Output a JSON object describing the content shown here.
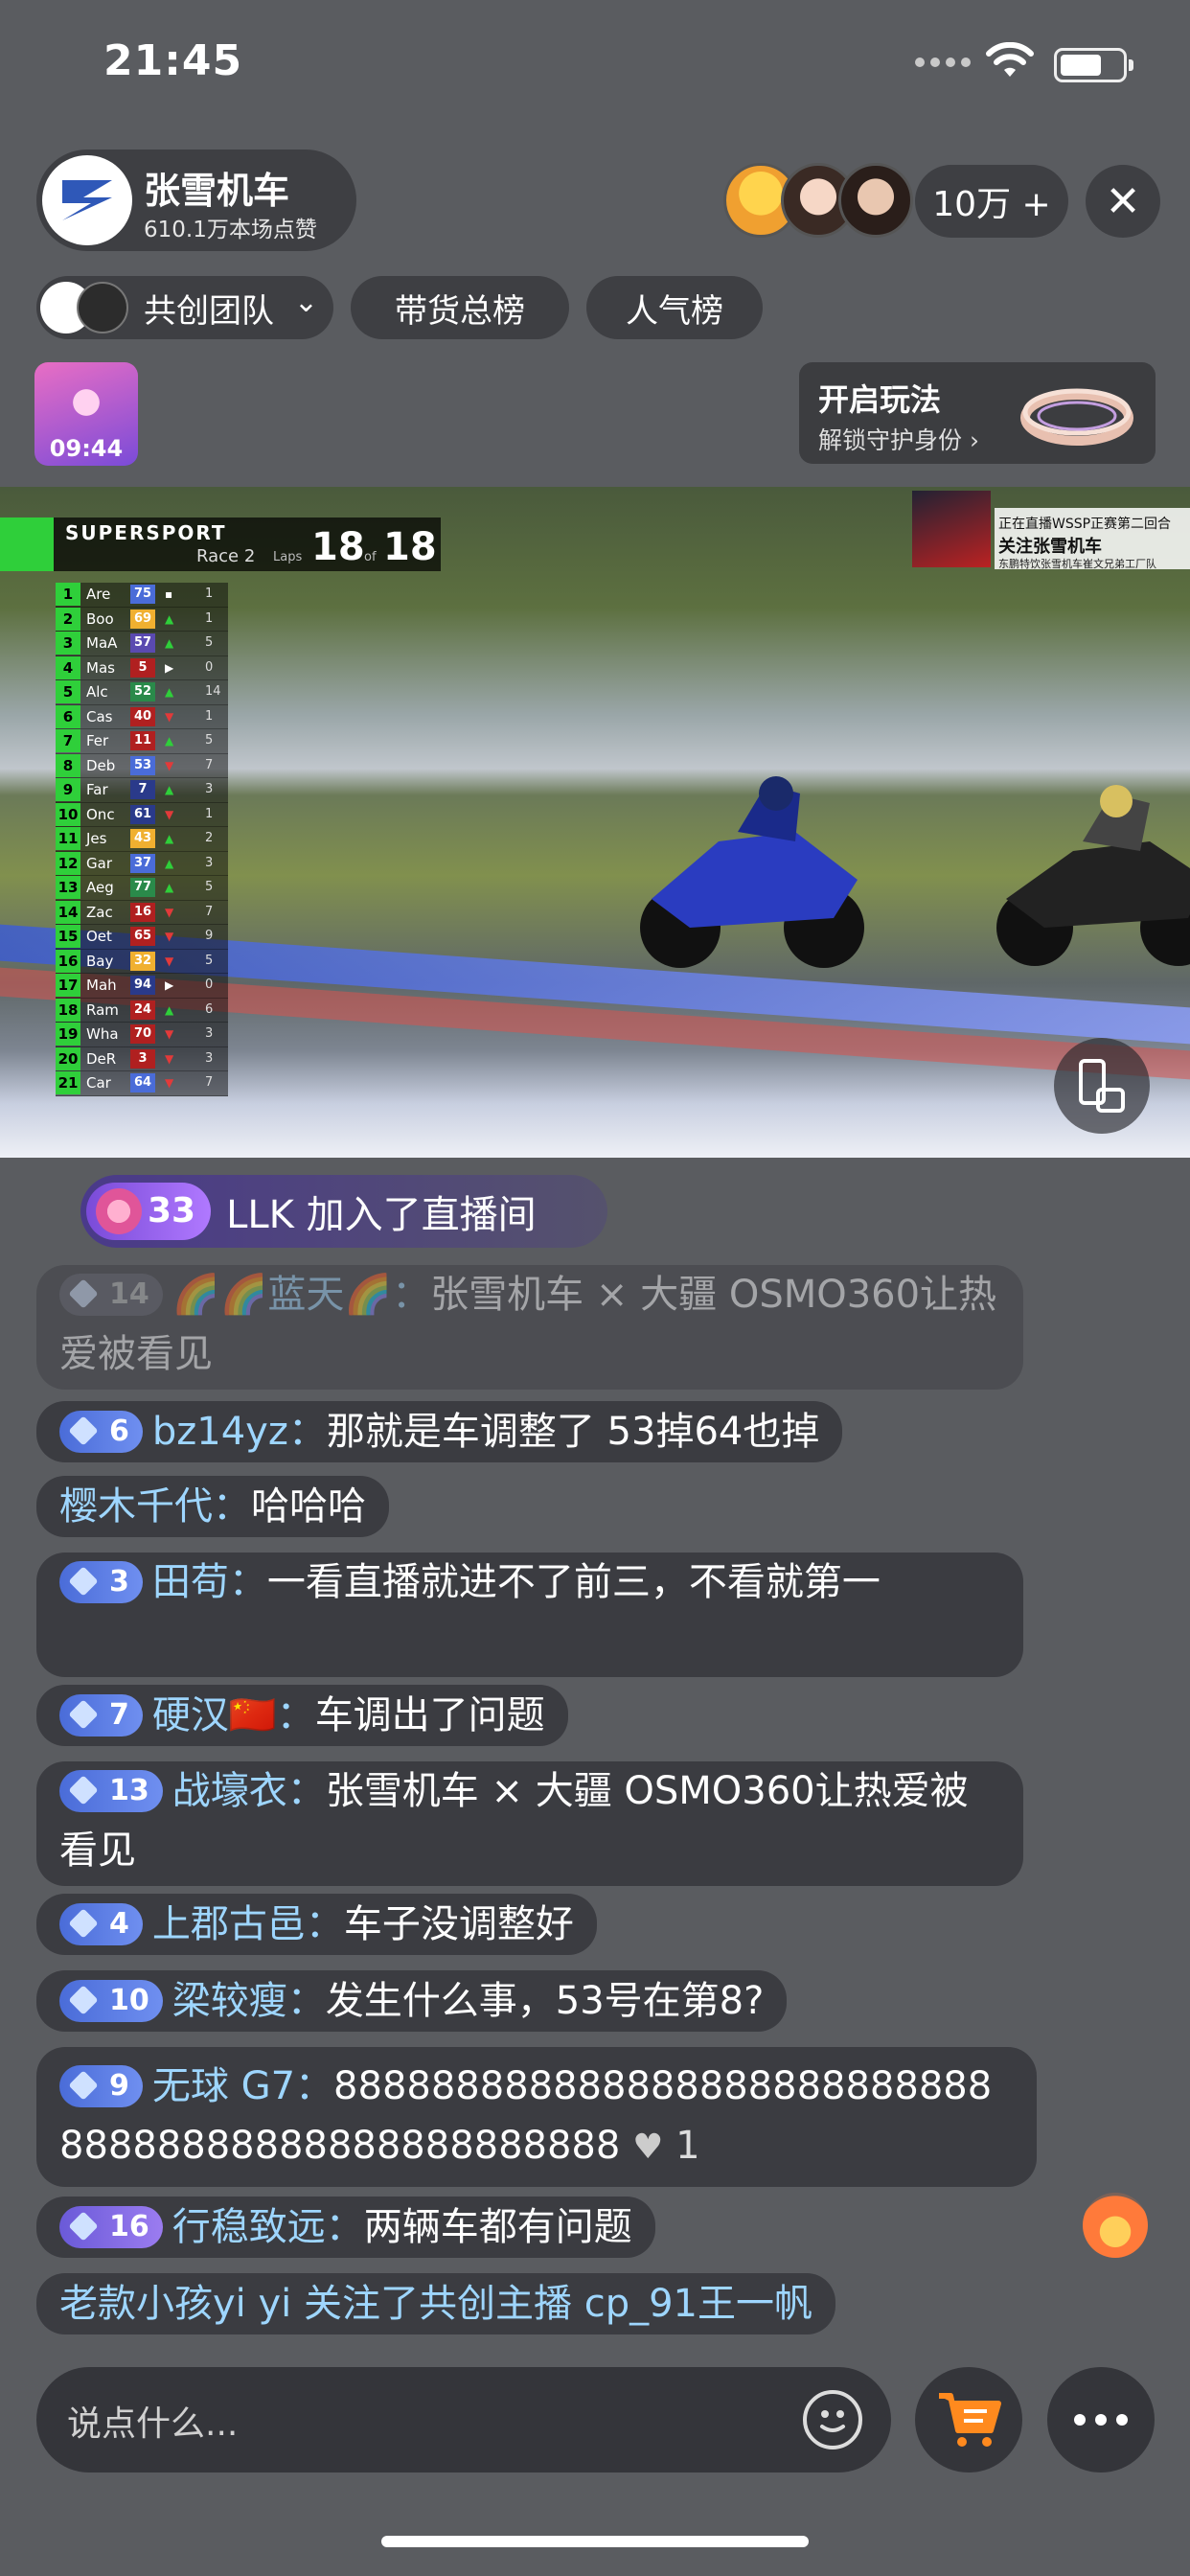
{
  "status_bar": {
    "time": "21:45"
  },
  "host": {
    "name": "张雪机车",
    "likes": "610.1万本场点赞"
  },
  "viewers": {
    "count": "10万 +",
    "close": "✕"
  },
  "tabs": [
    {
      "label": "共创团队"
    },
    {
      "label": "带货总榜"
    },
    {
      "label": "人气榜"
    }
  ],
  "gift": {
    "timer": "09:44"
  },
  "play_card": {
    "title": "开启玩法",
    "subtitle": "解锁守护身份 ›"
  },
  "video": {
    "series": "SUPERSPORT",
    "race": "Race 2",
    "laps_label": "Laps",
    "laps_current": "18",
    "laps_of": "of",
    "laps_total": "18",
    "promo": {
      "line1": "正在直播WSSP正赛第二回合",
      "line2": "关注张雪机车",
      "line3": "东鹏特饮张雪机车崔文兄弟工厂队"
    },
    "standings": [
      {
        "pos": "1",
        "name": "Are",
        "num": "75",
        "color": "#4a6cd8",
        "arrow": "▪",
        "delta": "1"
      },
      {
        "pos": "2",
        "name": "Boo",
        "num": "69",
        "color": "#f0b030",
        "arrow": "▲",
        "delta": "1"
      },
      {
        "pos": "3",
        "name": "MaA",
        "num": "57",
        "color": "#5a4ab0",
        "arrow": "▲",
        "delta": "5"
      },
      {
        "pos": "4",
        "name": "Mas",
        "num": "5",
        "color": "#b02020",
        "arrow": "▶",
        "delta": "0"
      },
      {
        "pos": "5",
        "name": "Alc",
        "num": "52",
        "color": "#2a8a4a",
        "arrow": "▲",
        "delta": "14"
      },
      {
        "pos": "6",
        "name": "Cas",
        "num": "40",
        "color": "#b02020",
        "arrow": "▼",
        "delta": "1"
      },
      {
        "pos": "7",
        "name": "Fer",
        "num": "11",
        "color": "#b02020",
        "arrow": "▲",
        "delta": "5"
      },
      {
        "pos": "8",
        "name": "Deb",
        "num": "53",
        "color": "#4a6cd8",
        "arrow": "▼",
        "delta": "7"
      },
      {
        "pos": "9",
        "name": "Far",
        "num": "7",
        "color": "#2a3a8a",
        "arrow": "▲",
        "delta": "3"
      },
      {
        "pos": "10",
        "name": "Onc",
        "num": "61",
        "color": "#2a3a8a",
        "arrow": "▼",
        "delta": "1"
      },
      {
        "pos": "11",
        "name": "Jes",
        "num": "43",
        "color": "#f0b030",
        "arrow": "▲",
        "delta": "2"
      },
      {
        "pos": "12",
        "name": "Gar",
        "num": "37",
        "color": "#4a6cd8",
        "arrow": "▲",
        "delta": "3"
      },
      {
        "pos": "13",
        "name": "Aeg",
        "num": "77",
        "color": "#2a8a4a",
        "arrow": "▲",
        "delta": "5"
      },
      {
        "pos": "14",
        "name": "Zac",
        "num": "16",
        "color": "#b02020",
        "arrow": "▼",
        "delta": "7"
      },
      {
        "pos": "15",
        "name": "Oet",
        "num": "65",
        "color": "#b02020",
        "arrow": "▼",
        "delta": "9"
      },
      {
        "pos": "16",
        "name": "Bay",
        "num": "32",
        "color": "#f0b030",
        "arrow": "▼",
        "delta": "5"
      },
      {
        "pos": "17",
        "name": "Mah",
        "num": "94",
        "color": "#2a3a8a",
        "arrow": "▶",
        "delta": "0"
      },
      {
        "pos": "18",
        "name": "Ram",
        "num": "24",
        "color": "#b02020",
        "arrow": "▲",
        "delta": "6"
      },
      {
        "pos": "19",
        "name": "Wha",
        "num": "70",
        "color": "#b02020",
        "arrow": "▼",
        "delta": "3"
      },
      {
        "pos": "20",
        "name": "DeR",
        "num": "3",
        "color": "#b02020",
        "arrow": "▼",
        "delta": "3"
      },
      {
        "pos": "21",
        "name": "Car",
        "num": "64",
        "color": "#4a6cd8",
        "arrow": "▼",
        "delta": "7"
      }
    ]
  },
  "join": {
    "level": "33",
    "text": "LLK 加入了直播间"
  },
  "comments": {
    "faded": {
      "level": "14",
      "name": "🌈🌈蓝天🌈：",
      "text": "张雪机车 × 大疆 OSMO360让热爱被看见"
    },
    "c1": {
      "level": "6",
      "name": "bz14yz：",
      "text": "那就是车调整了 53掉64也掉"
    },
    "c2": {
      "name": "樱木千代：",
      "text": "哈哈哈"
    },
    "c3": {
      "level": "3",
      "name": "田苟：",
      "text": "一看直播就进不了前三，不看就第一"
    },
    "c4": {
      "level": "7",
      "name": "硬汉🇨🇳：",
      "text": "车调出了问题"
    },
    "c5": {
      "level": "13",
      "name": "战壕衣：",
      "text": "张雪机车 × 大疆 OSMO360让热爱被看见"
    },
    "c6": {
      "level": "4",
      "name": "上郡古邑：",
      "text": "车子没调整好"
    },
    "c7": {
      "level": "10",
      "name": "梁较瘦：",
      "text": "发生什么事，53号在第8?"
    },
    "c8": {
      "level": "9",
      "name": "无球 G7：",
      "text": "88888888888888888888888888888888888888888888888888",
      "likes": "1"
    },
    "c9": {
      "level": "16",
      "name": "行稳致远：",
      "text": "两辆车都有问题"
    },
    "c10": {
      "text": "老款小孩yi yi 关注了共创主播 cp_91王一帆"
    }
  },
  "input": {
    "placeholder": "说点什么..."
  },
  "icons": {
    "wifi": "wifi-icon",
    "battery": "battery-icon",
    "close": "close-icon",
    "chevron": "chevron-down-icon",
    "emoji": "emoji-icon",
    "cart": "cart-icon",
    "more": "more-icon",
    "rotate": "rotate-screen-icon",
    "flame": "flame-icon",
    "heart": "heart-icon"
  }
}
